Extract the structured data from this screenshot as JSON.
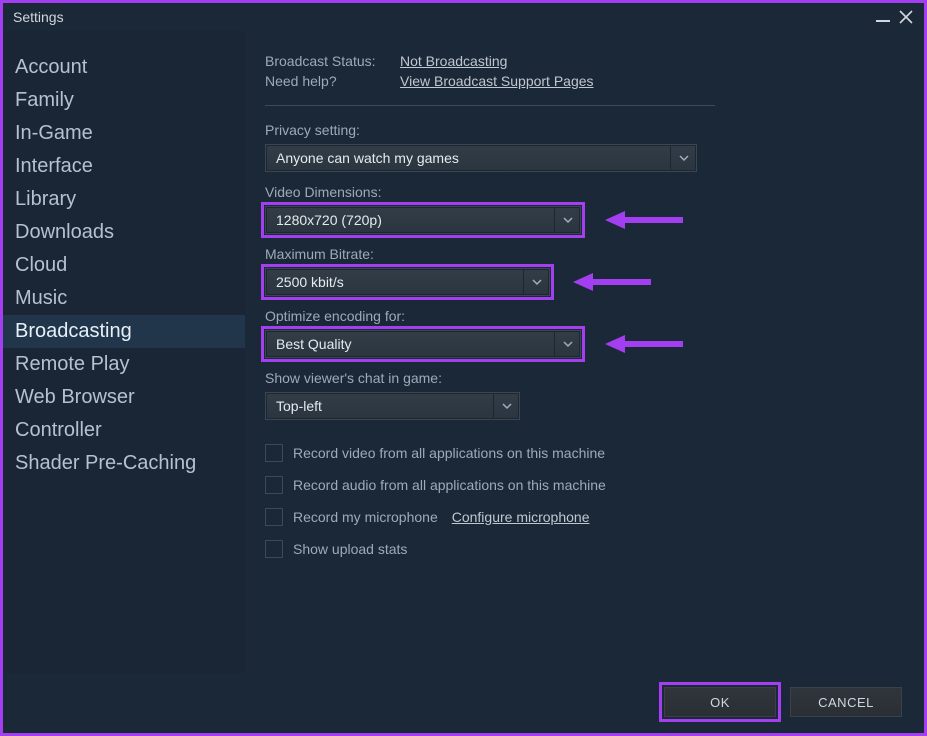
{
  "window": {
    "title": "Settings"
  },
  "sidebar": {
    "items": [
      {
        "label": "Account"
      },
      {
        "label": "Family"
      },
      {
        "label": "In-Game"
      },
      {
        "label": "Interface"
      },
      {
        "label": "Library"
      },
      {
        "label": "Downloads"
      },
      {
        "label": "Cloud"
      },
      {
        "label": "Music"
      },
      {
        "label": "Broadcasting"
      },
      {
        "label": "Remote Play"
      },
      {
        "label": "Web Browser"
      },
      {
        "label": "Controller"
      },
      {
        "label": "Shader Pre-Caching"
      }
    ],
    "active_index": 8
  },
  "main": {
    "status": {
      "label": "Broadcast Status:",
      "value": "Not Broadcasting",
      "help_label": "Need help?",
      "help_link": "View Broadcast Support Pages"
    },
    "privacy": {
      "label": "Privacy setting:",
      "value": "Anyone can watch my games"
    },
    "video": {
      "label": "Video Dimensions:",
      "value": "1280x720 (720p)"
    },
    "bitrate": {
      "label": "Maximum Bitrate:",
      "value": "2500 kbit/s"
    },
    "encoding": {
      "label": "Optimize encoding for:",
      "value": "Best Quality"
    },
    "chat": {
      "label": "Show viewer's chat in game:",
      "value": "Top-left"
    },
    "checkboxes": {
      "record_video": "Record video from all applications on this machine",
      "record_audio": "Record audio from all applications on this machine",
      "record_mic": "Record my microphone",
      "configure_mic": "Configure microphone",
      "upload_stats": "Show upload stats"
    }
  },
  "footer": {
    "ok": "OK",
    "cancel": "CANCEL"
  },
  "colors": {
    "accent": "#a33ef1"
  }
}
